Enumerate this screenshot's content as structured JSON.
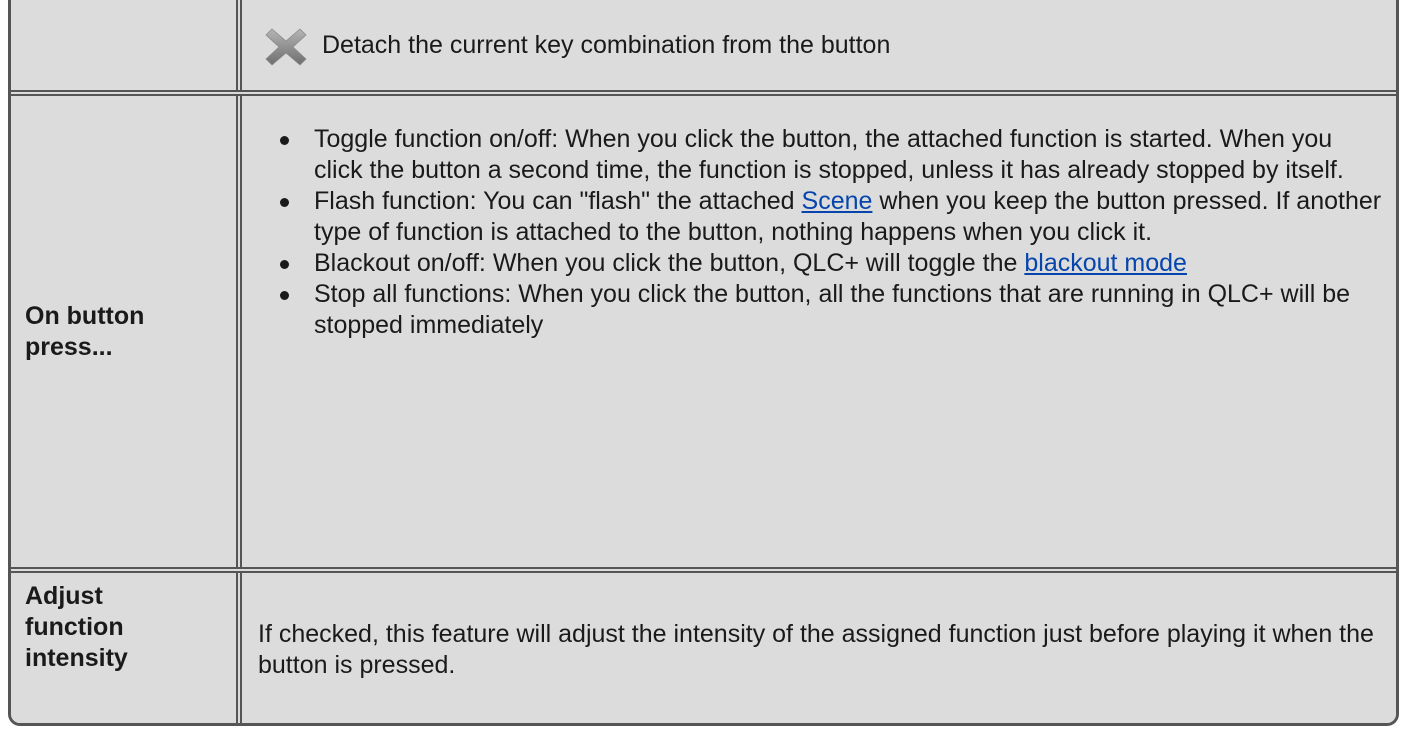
{
  "rows": {
    "detach": {
      "label": "",
      "icon": "detach-x-icon",
      "text": "Detach the current key combination from the button"
    },
    "press": {
      "label_line1": "On button",
      "label_line2": "press...",
      "items": [
        {
          "text": "Toggle function on/off: When you click the button, the attached function is started. When you click the button a second time, the function is stopped, unless it has already stopped by itself."
        },
        {
          "text_before": "Flash function: You can \"flash\" the attached ",
          "link": "Scene",
          "text_after": " when you keep the button pressed. If another type of function is attached to the button, nothing happens when you click it."
        },
        {
          "text_before": "Blackout on/off: When you click the button, QLC+ will toggle the ",
          "link": "blackout mode",
          "text_after": ""
        },
        {
          "text": "Stop all functions: When you click the button, all the functions that are running in QLC+ will be stopped immediately"
        }
      ]
    },
    "adjust": {
      "label_line1": "Adjust",
      "label_line2": "function",
      "label_line3": "intensity",
      "text": "If checked, this feature will adjust the intensity of the assigned function just before playing it when the button is pressed."
    }
  },
  "colors": {
    "cell_bg": "#dcdcdc",
    "border": "#555555",
    "link": "#0645ad"
  }
}
